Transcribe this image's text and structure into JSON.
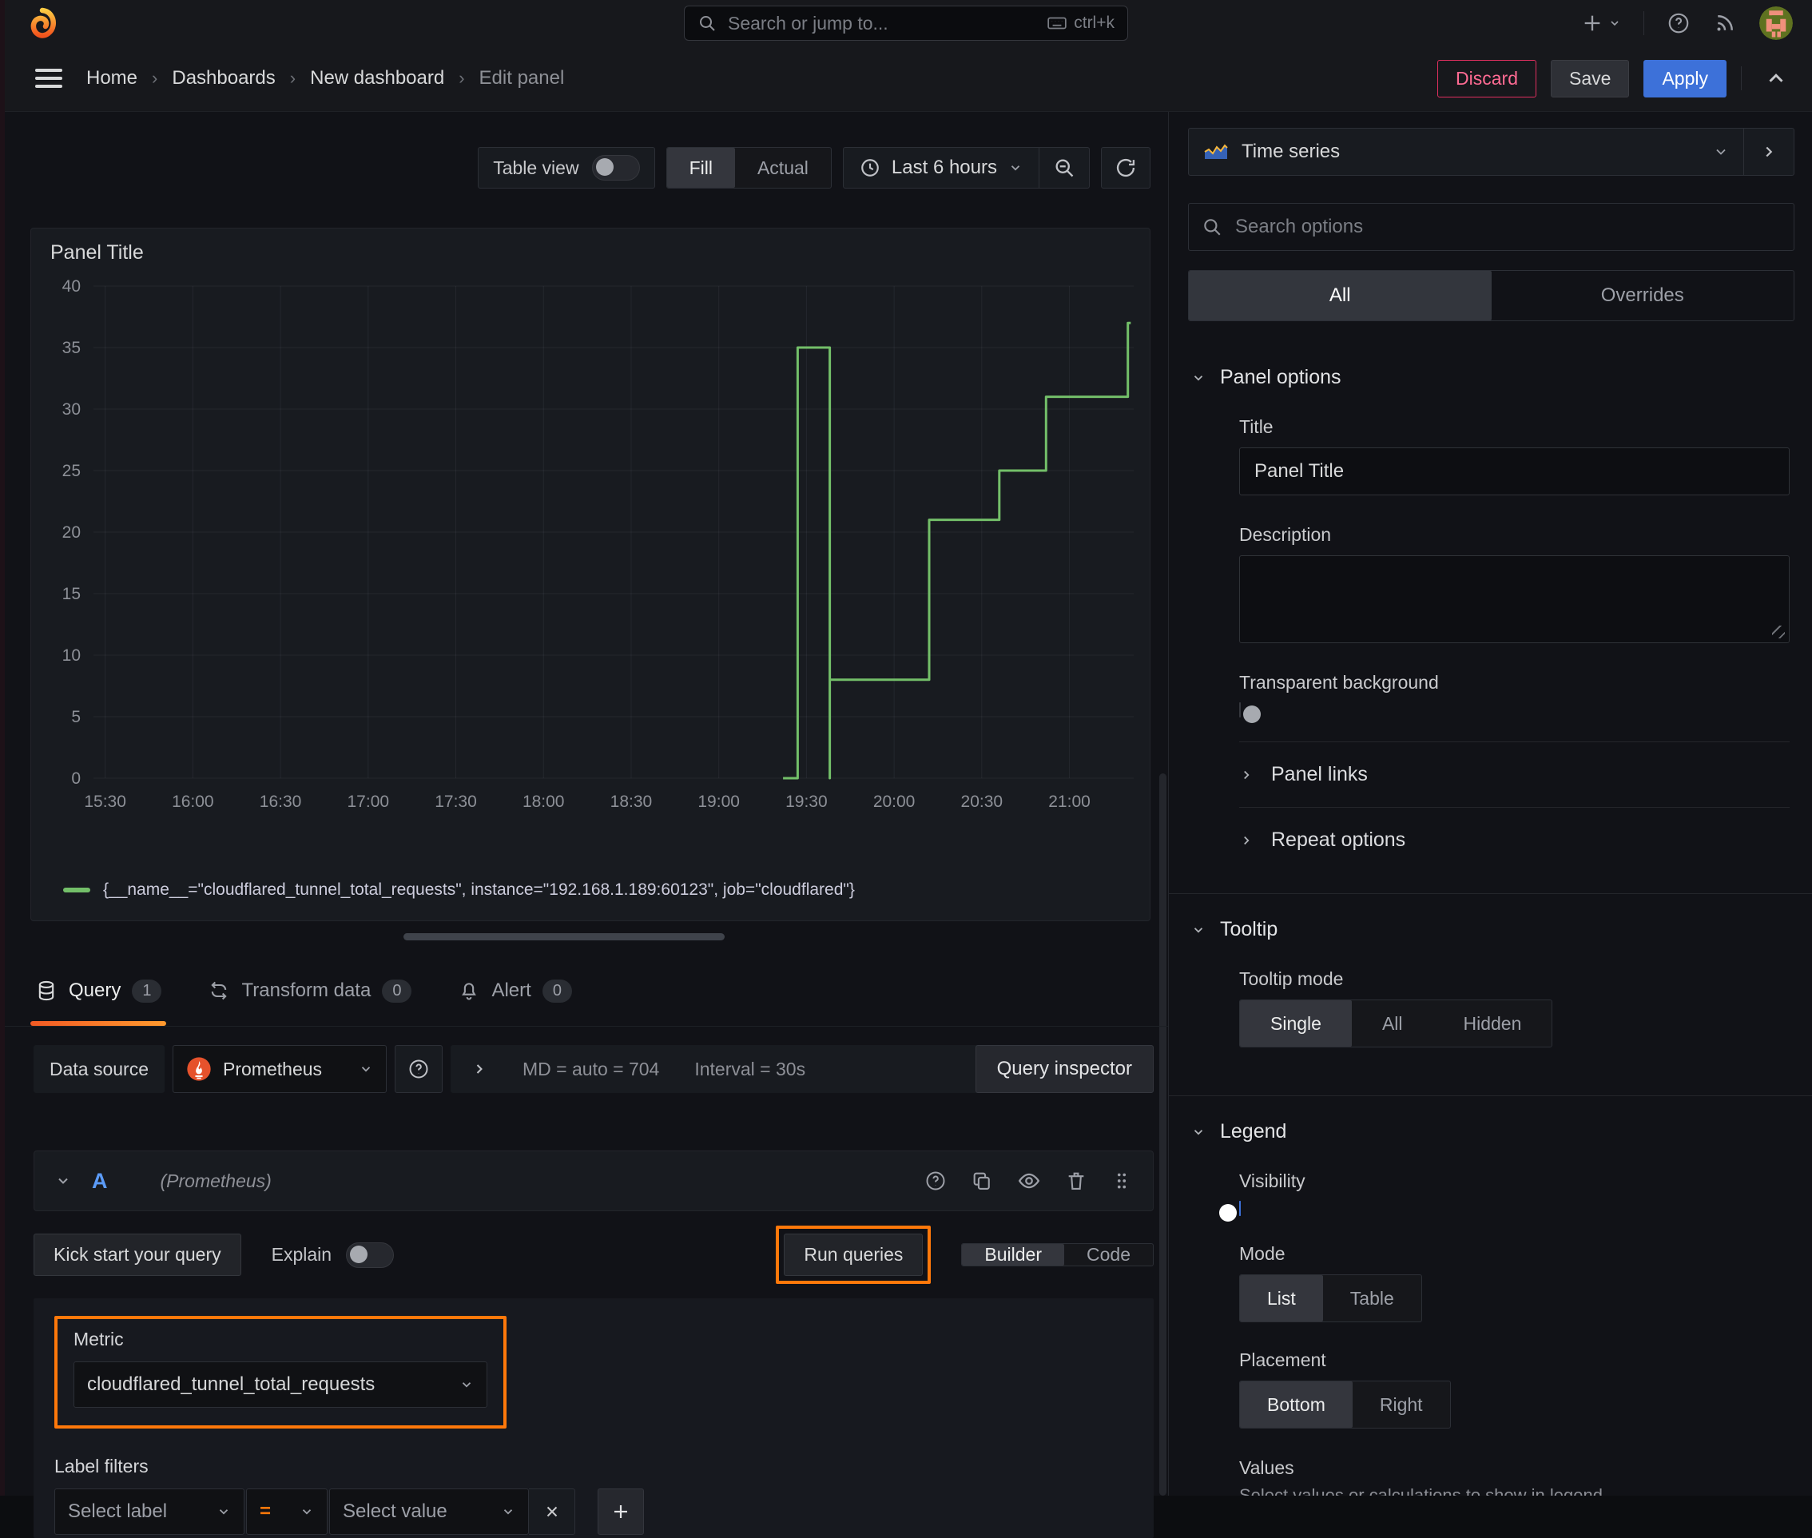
{
  "topbar": {
    "search_placeholder": "Search or jump to...",
    "shortcut": "ctrl+k"
  },
  "breadcrumb": {
    "items": [
      "Home",
      "Dashboards",
      "New dashboard",
      "Edit panel"
    ]
  },
  "actions": {
    "discard": "Discard",
    "save": "Save",
    "apply": "Apply"
  },
  "view_toolbar": {
    "table_view": "Table view",
    "fill": "Fill",
    "actual": "Actual",
    "time_range": "Last 6 hours"
  },
  "panel": {
    "title": "Panel Title"
  },
  "chart_data": {
    "type": "line",
    "line_style": "step-after",
    "title": "Panel Title",
    "xlabel": "",
    "ylabel": "",
    "ylim": [
      0,
      40
    ],
    "y_ticks": [
      0,
      5,
      10,
      15,
      20,
      25,
      30,
      35,
      40
    ],
    "x_ticks": [
      "15:30",
      "16:00",
      "16:30",
      "17:00",
      "17:30",
      "18:00",
      "18:30",
      "19:00",
      "19:30",
      "20:00",
      "20:30",
      "21:00"
    ],
    "x_domain": [
      "15:26",
      "21:22"
    ],
    "grid": true,
    "legend_position": "bottom",
    "series": [
      {
        "name": "{__name__=\"cloudflared_tunnel_total_requests\", instance=\"192.168.1.189:60123\", job=\"cloudflared\"}",
        "color": "#73bf69",
        "description": "Counter at 0 until 19:27, spikes to 35, resets to 0 at 19:38, then steps up 8 -> 21 -> 25 -> 31 -> 37",
        "points": [
          [
            "19:22",
            0
          ],
          [
            "19:27",
            0
          ],
          [
            "19:27",
            35
          ],
          [
            "19:38",
            35
          ],
          [
            "19:38",
            0
          ],
          [
            "19:38",
            8
          ],
          [
            "20:12",
            8
          ],
          [
            "20:12",
            21
          ],
          [
            "20:36",
            21
          ],
          [
            "20:36",
            25
          ],
          [
            "20:52",
            25
          ],
          [
            "20:52",
            31
          ],
          [
            "21:20",
            31
          ],
          [
            "21:20",
            37
          ],
          [
            "21:21",
            37
          ]
        ]
      }
    ]
  },
  "query_tabs": {
    "query": {
      "label": "Query",
      "count": "1"
    },
    "transform": {
      "label": "Transform data",
      "count": "0"
    },
    "alert": {
      "label": "Alert",
      "count": "0"
    }
  },
  "datasource_row": {
    "label": "Data source",
    "name": "Prometheus",
    "max_data_points": "MD = auto = 704",
    "interval": "Interval = 30s",
    "inspector": "Query inspector"
  },
  "query_editor": {
    "ref_id": "A",
    "ds_hint": "(Prometheus)",
    "kickstart": "Kick start your query",
    "explain": "Explain",
    "run_queries": "Run queries",
    "builder": "Builder",
    "code": "Code",
    "metric_label": "Metric",
    "metric_value": "cloudflared_tunnel_total_requests",
    "label_filters_label": "Label filters",
    "select_label": "Select label",
    "operator": "=",
    "select_value": "Select value"
  },
  "options_pane": {
    "visualization": "Time series",
    "search_placeholder": "Search options",
    "filter_tabs": [
      "All",
      "Overrides"
    ],
    "panel_options": {
      "header": "Panel options",
      "title_label": "Title",
      "title_value": "Panel Title",
      "description_label": "Description",
      "transparent_label": "Transparent background"
    },
    "collapsed": [
      "Panel links",
      "Repeat options"
    ],
    "tooltip": {
      "header": "Tooltip",
      "mode_label": "Tooltip mode",
      "options": [
        "Single",
        "All",
        "Hidden"
      ],
      "selected": "Single"
    },
    "legend": {
      "header": "Legend",
      "visibility_label": "Visibility",
      "mode_label": "Mode",
      "mode_options": [
        "List",
        "Table"
      ],
      "mode_selected": "List",
      "placement_label": "Placement",
      "placement_options": [
        "Bottom",
        "Right"
      ],
      "placement_selected": "Bottom",
      "values_label": "Values",
      "values_hint": "Select values or calculations to show in legend"
    }
  },
  "colors": {
    "accent_orange": "#ff780a",
    "apply_blue": "#3d71d9",
    "discard_pink": "#ff6b93",
    "series_green": "#73bf69",
    "toggle_blue": "#3d71d9"
  }
}
